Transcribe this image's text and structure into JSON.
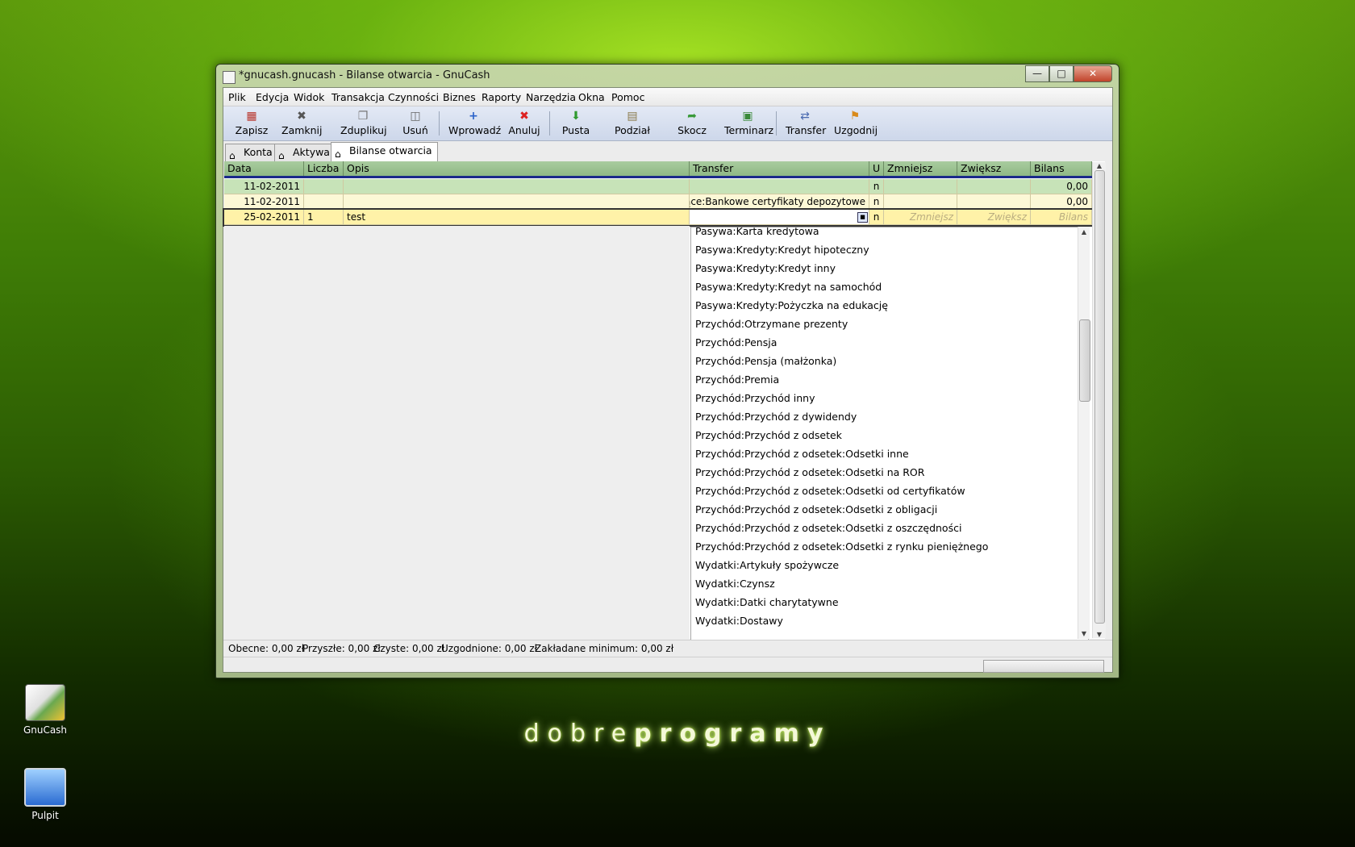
{
  "window": {
    "title": "*gnucash.gnucash - Bilanse otwarcia - GnuCash"
  },
  "menu": [
    "Plik",
    "Edycja",
    "Widok",
    "Transakcja",
    "Czynności",
    "Biznes",
    "Raporty",
    "Narzędzia",
    "Okna",
    "Pomoc"
  ],
  "toolbar": {
    "save": "Zapisz",
    "close": "Zamknij",
    "duplicate": "Zduplikuj",
    "delete": "Usuń",
    "enter": "Wprowadź",
    "cancel": "Anuluj",
    "blank": "Pusta",
    "split": "Podział",
    "jump": "Skocz",
    "schedule": "Terminarz",
    "transfer": "Transfer",
    "reconcile": "Uzgodnij"
  },
  "tabs": [
    "Konta",
    "Aktywa",
    "Bilanse otwarcia"
  ],
  "columns": {
    "date": "Data",
    "num": "Liczba",
    "desc": "Opis",
    "transfer": "Transfer",
    "r": "U",
    "decrease": "Zmniejsz",
    "increase": "Zwiększ",
    "balance": "Bilans"
  },
  "rows": [
    {
      "date": "11-02-2011",
      "num": "",
      "desc": "",
      "transfer": "",
      "r": "n",
      "decrease": "",
      "increase": "",
      "balance": "0,00"
    },
    {
      "date": "11-02-2011",
      "num": "",
      "desc": "",
      "transfer": "bieżące:Bankowe certyfikaty depozytowe",
      "r": "n",
      "decrease": "",
      "increase": "",
      "balance": "0,00"
    },
    {
      "date": "25-02-2011",
      "num": "1",
      "desc": "test",
      "transfer": "",
      "r": "n",
      "decrease": "Zmniejsz",
      "increase": "Zwiększ",
      "balance": "Bilans"
    }
  ],
  "dropdown": [
    "Pasywa:Karta kredytowa",
    "Pasywa:Kredyty:Kredyt hipoteczny",
    "Pasywa:Kredyty:Kredyt inny",
    "Pasywa:Kredyty:Kredyt na samochód",
    "Pasywa:Kredyty:Pożyczka na edukację",
    "Przychód:Otrzymane prezenty",
    "Przychód:Pensja",
    "Przychód:Pensja (małżonka)",
    "Przychód:Premia",
    "Przychód:Przychód inny",
    "Przychód:Przychód z dywidendy",
    "Przychód:Przychód z odsetek",
    "Przychód:Przychód z odsetek:Odsetki inne",
    "Przychód:Przychód z odsetek:Odsetki na ROR",
    "Przychód:Przychód z odsetek:Odsetki od certyfikatów",
    "Przychód:Przychód z odsetek:Odsetki z obligacji",
    "Przychód:Przychód z odsetek:Odsetki z oszczędności",
    "Przychód:Przychód z odsetek:Odsetki z rynku pieniężnego",
    "Wydatki:Artykuły spożywcze",
    "Wydatki:Czynsz",
    "Wydatki:Datki charytatywne",
    "Wydatki:Dostawy"
  ],
  "summary": {
    "present": "Obecne: 0,00 zł",
    "future": "Przyszłe: 0,00 zł",
    "cleared": "Czyste: 0,00 zł",
    "reconciled": "Uzgodnione: 0,00 zł",
    "projected": "Zakładane minimum: 0,00 zł"
  },
  "desktop": {
    "gnucash": "GnuCash",
    "pulpit": "Pulpit",
    "brand_light": "dobre",
    "brand_bold": "programy"
  }
}
